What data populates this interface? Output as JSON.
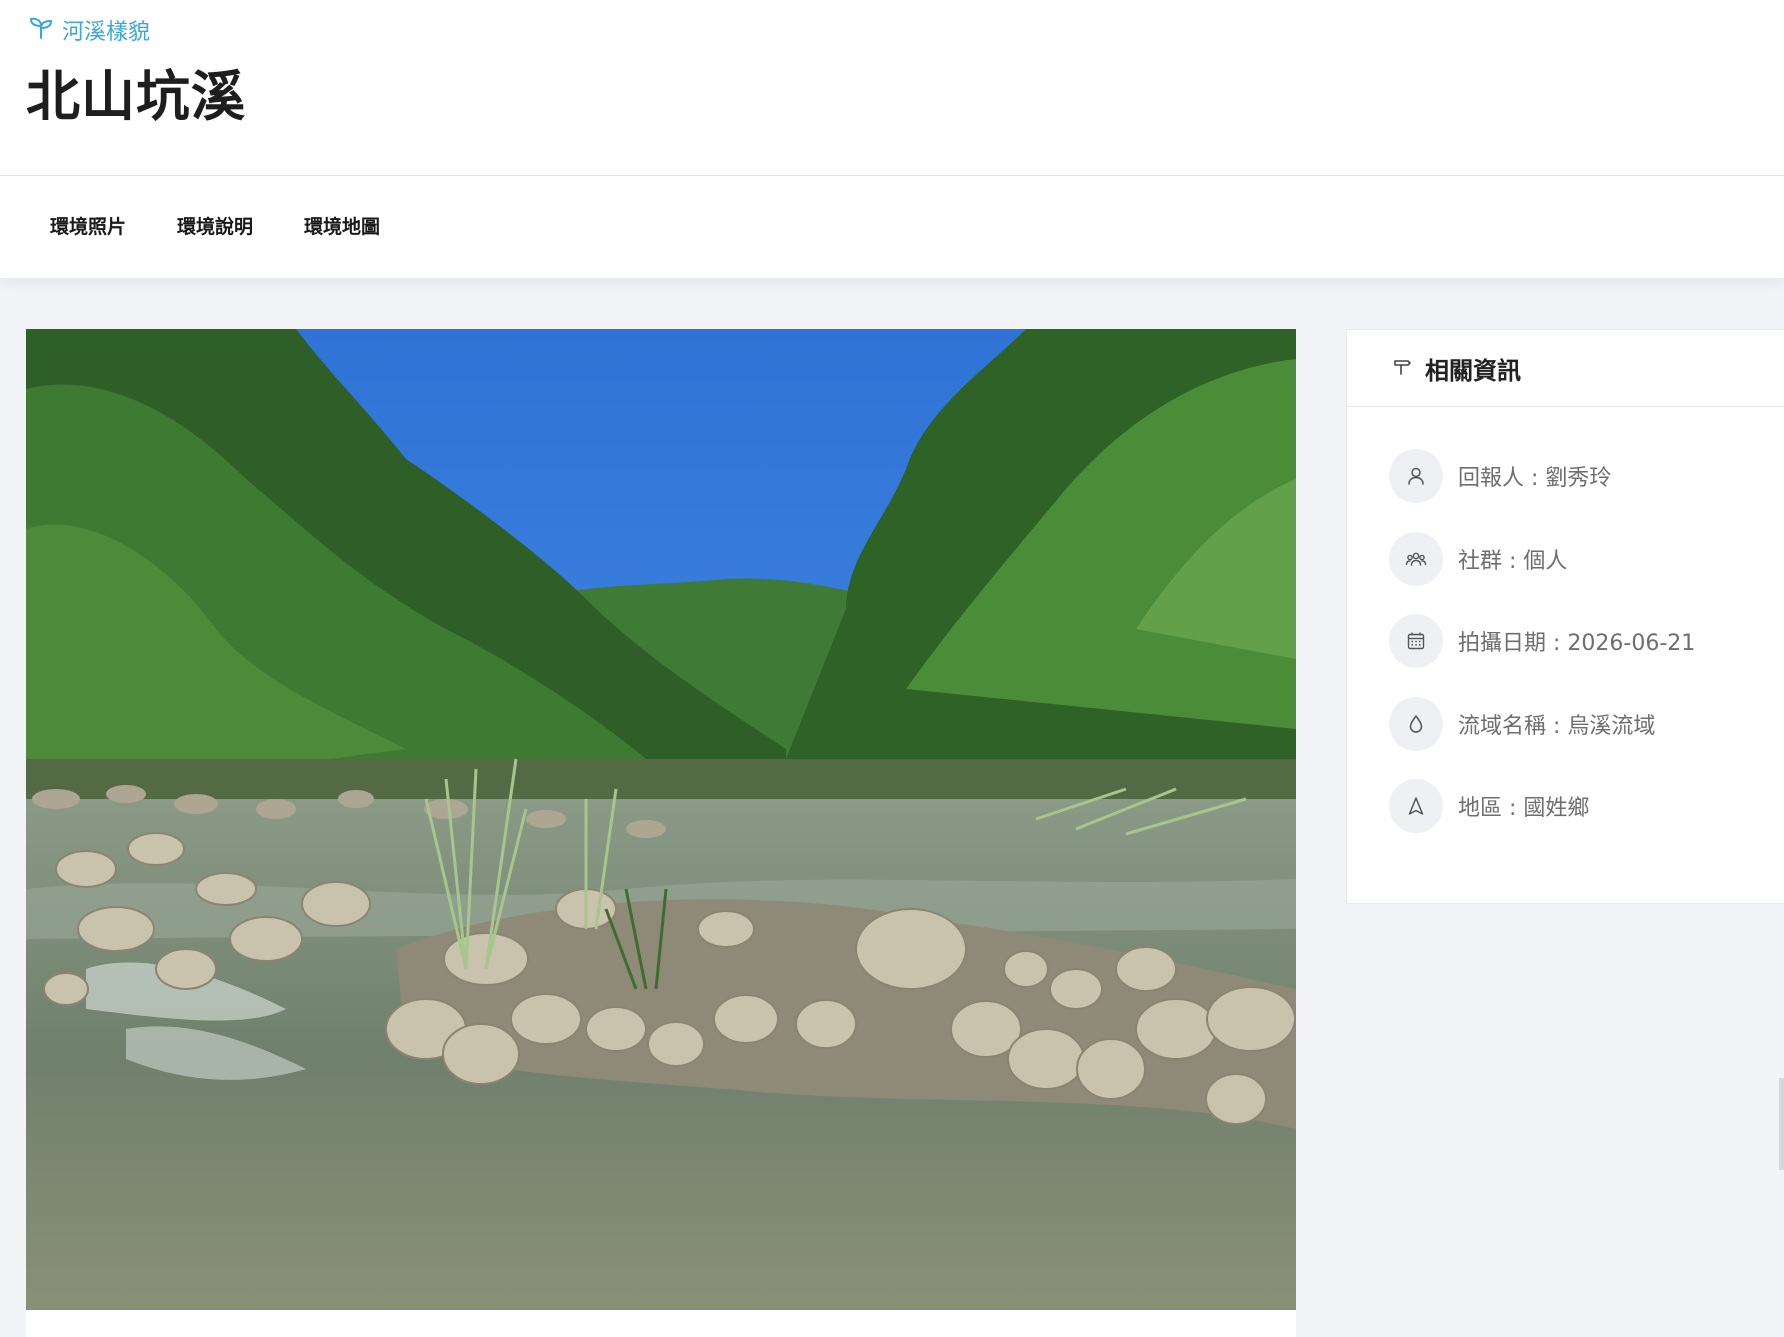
{
  "header": {
    "breadcrumb": "河溪樣貌",
    "title": "北山坑溪"
  },
  "tabs": [
    {
      "label": "環境照片"
    },
    {
      "label": "環境說明"
    },
    {
      "label": "環境地圖"
    }
  ],
  "photo": {
    "alt": "北山坑溪"
  },
  "info": {
    "title": "相關資訊",
    "items": [
      {
        "icon": "user-icon",
        "text": "回報人 : 劉秀玲"
      },
      {
        "icon": "group-icon",
        "text": "社群 : 個人"
      },
      {
        "icon": "calendar-icon",
        "text": "拍攝日期 : 2026-06-21"
      },
      {
        "icon": "water-drop-icon",
        "text": "流域名稱 : 烏溪流域"
      },
      {
        "icon": "navigation-arrow-icon",
        "text": "地區 : 國姓鄉"
      }
    ]
  },
  "colors": {
    "accent": "#38a8dc",
    "background": "#f3f4f7",
    "text_muted": "#6e6e6e"
  }
}
